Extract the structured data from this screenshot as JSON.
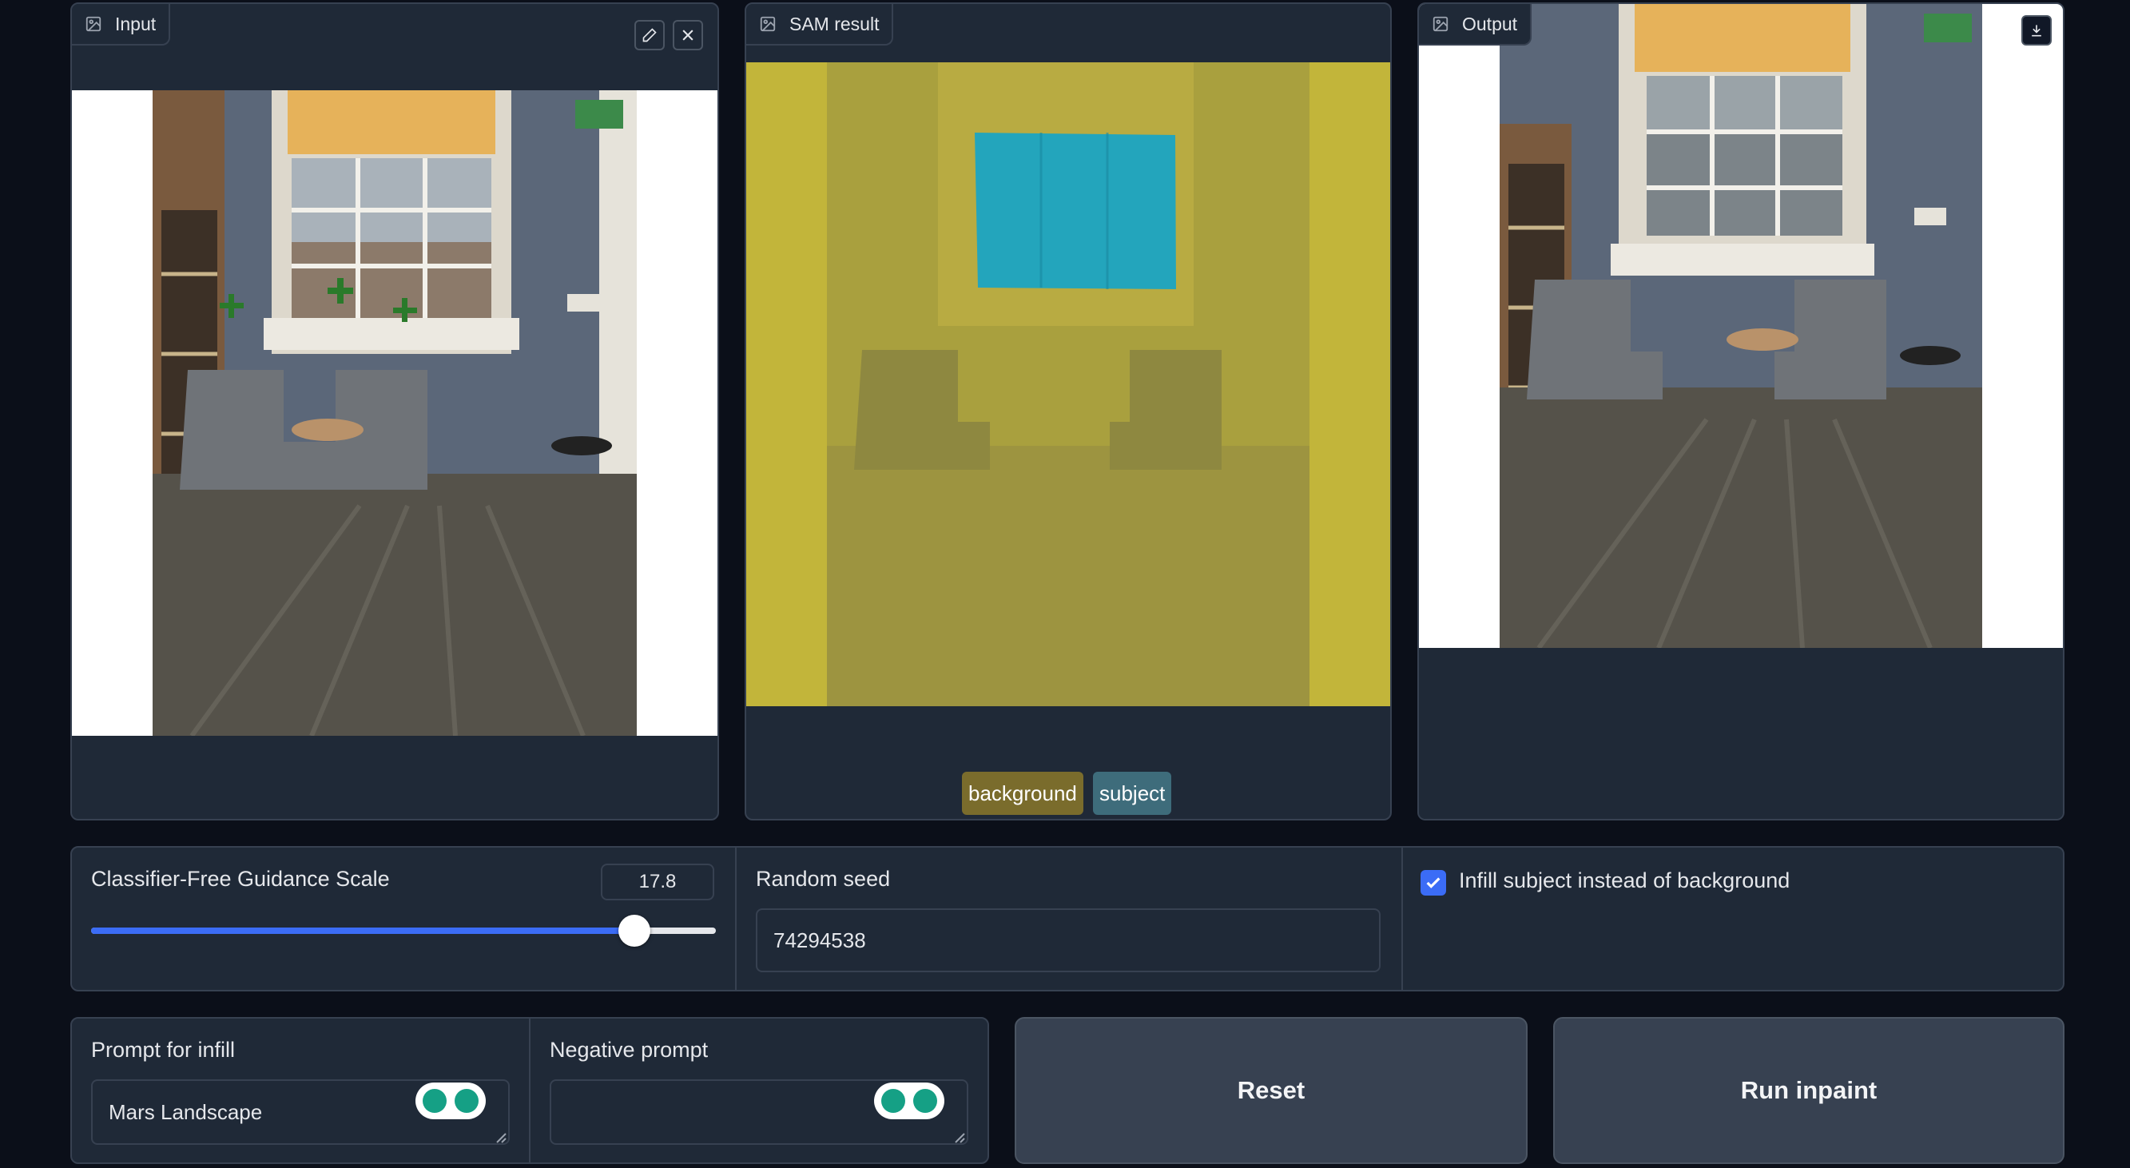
{
  "panels": {
    "input": {
      "label": "Input",
      "edit_icon": "pencil-icon",
      "close_icon": "close-icon"
    },
    "sam": {
      "label": "SAM result",
      "legend": [
        {
          "label": "background",
          "color": "#7a6c2c"
        },
        {
          "label": "subject",
          "color": "#3e6c7b"
        }
      ]
    },
    "output": {
      "label": "Output",
      "download_icon": "download-icon"
    }
  },
  "controls": {
    "cfg": {
      "label": "Classifier-Free Guidance Scale",
      "value": "17.8",
      "level": 0.87
    },
    "seed": {
      "label": "Random seed",
      "value": "74294538"
    },
    "infill_subject": {
      "label": "Infill subject instead of background",
      "checked": true
    }
  },
  "prompts": {
    "infill": {
      "label": "Prompt for infill",
      "value": "Mars Landscape"
    },
    "negative": {
      "label": "Negative prompt",
      "value": ""
    }
  },
  "buttons": {
    "reset": "Reset",
    "run": "Run inpaint"
  },
  "colors": {
    "accent": "#3b6cf6",
    "background": "#0b0f19",
    "panel": "#1f2937"
  }
}
